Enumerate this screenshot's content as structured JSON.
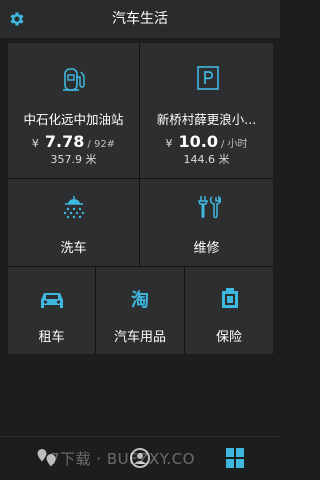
{
  "header": {
    "title": "汽车生活",
    "settings_icon": "gear-icon"
  },
  "gas_station": {
    "name": "中石化远中加油站",
    "currency": "¥",
    "price": "7.78",
    "unit": "/ 92#",
    "distance": "357.9 米",
    "icon": "fuel-pump-icon"
  },
  "parking": {
    "name": "新桥村薛更浪小...",
    "currency": "¥",
    "price": "10.0",
    "unit": "/ 小时",
    "distance": "144.6 米",
    "icon": "parking-icon"
  },
  "services": {
    "car_wash": {
      "label": "洗车",
      "icon": "car-wash-icon"
    },
    "repair": {
      "label": "维修",
      "icon": "tools-icon"
    },
    "rental": {
      "label": "租车",
      "icon": "car-icon"
    },
    "supplies": {
      "label": "汽车用品",
      "icon": "taobao-icon"
    },
    "insurance": {
      "label": "保险",
      "icon": "insurance-icon"
    }
  },
  "watermark": "7下载 · BUFZXY.CO",
  "colors": {
    "accent": "#3fb8e0",
    "background": "#1c1d1f",
    "tile": "#2d2e30"
  }
}
